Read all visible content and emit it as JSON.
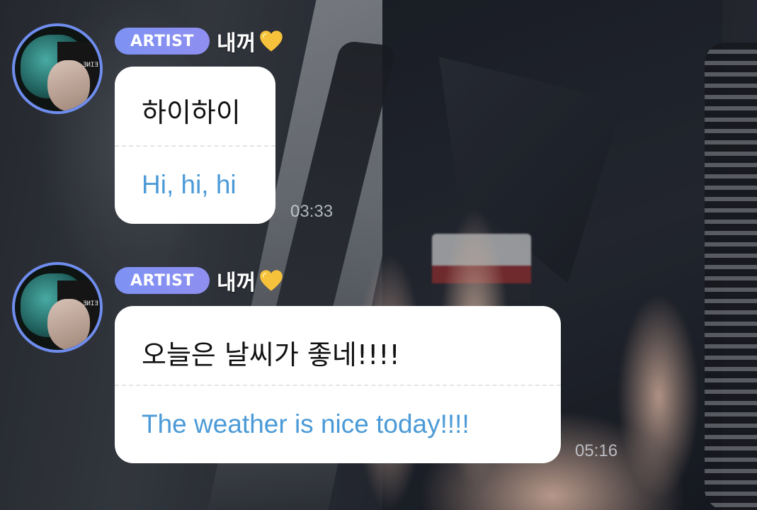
{
  "messages": [
    {
      "badge": "ARTIST",
      "sender": "내꺼",
      "original": "하이하이",
      "translation": "Hi, hi, hi",
      "time": "03:33"
    },
    {
      "badge": "ARTIST",
      "sender": "내꺼",
      "original": "오늘은 날씨가 좋네!!!!",
      "translation": "The weather is nice today!!!!",
      "time": "05:16"
    }
  ],
  "avatar_tag": "ƎИIƎ",
  "colors": {
    "badge": "#7d92f3",
    "translation_text": "#4b9ad7",
    "avatar_ring": "#6f8dee",
    "heart": "#f7c23b"
  },
  "icons": {
    "heart": "yellow-heart-icon"
  }
}
